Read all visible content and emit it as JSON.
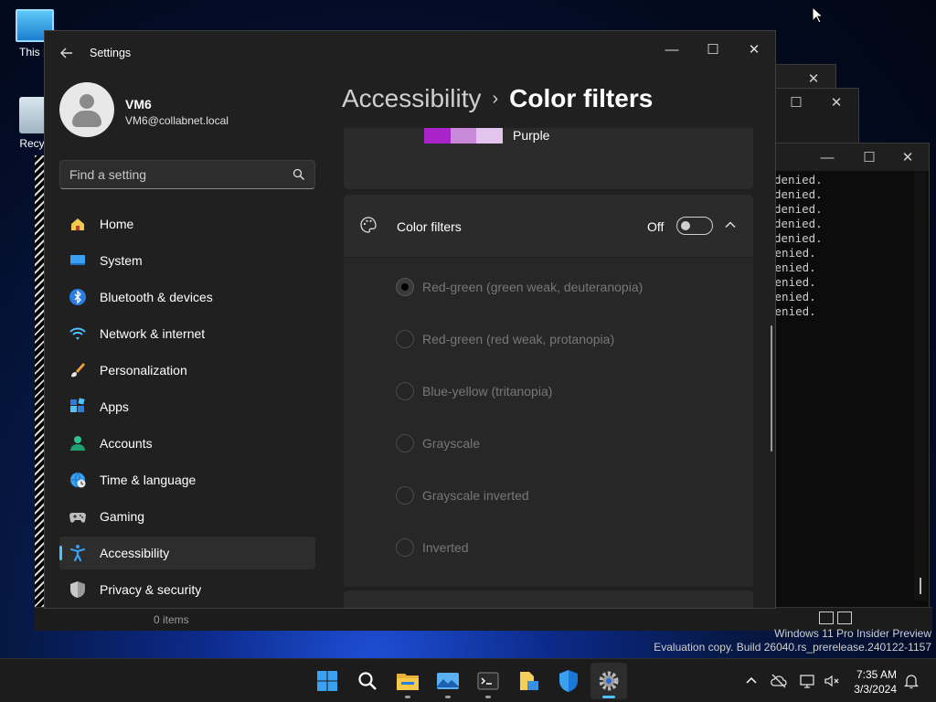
{
  "desktop": {
    "icons": [
      {
        "label": "This PC",
        "visible_label": "This P"
      },
      {
        "label": "Recycle Bin",
        "visible_label": "Recyc"
      }
    ]
  },
  "terminal": {
    "lines": [
      "denied.",
      "denied.",
      "denied.",
      "denied.",
      "denied.",
      "denied.",
      "denied.",
      "denied.",
      "denied.",
      "denied."
    ]
  },
  "explorer": {
    "status": "0 items"
  },
  "watermark": {
    "line1": "Windows 11 Pro Insider Preview",
    "line2": "Evaluation copy. Build 26040.rs_prerelease.240122-1157"
  },
  "settings": {
    "app_title": "Settings",
    "user": {
      "name": "VM6",
      "email": "VM6@collabnet.local"
    },
    "search": {
      "placeholder": "Find a setting"
    },
    "nav": [
      {
        "label": "Home",
        "icon": "home-icon"
      },
      {
        "label": "System",
        "icon": "system-icon"
      },
      {
        "label": "Bluetooth & devices",
        "icon": "bluetooth-icon"
      },
      {
        "label": "Network & internet",
        "icon": "wifi-icon"
      },
      {
        "label": "Personalization",
        "icon": "brush-icon"
      },
      {
        "label": "Apps",
        "icon": "apps-icon"
      },
      {
        "label": "Accounts",
        "icon": "accounts-icon"
      },
      {
        "label": "Time & language",
        "icon": "globe-clock-icon"
      },
      {
        "label": "Gaming",
        "icon": "gamepad-icon"
      },
      {
        "label": "Accessibility",
        "icon": "accessibility-icon",
        "selected": true
      },
      {
        "label": "Privacy & security",
        "icon": "shield-icon"
      }
    ],
    "breadcrumb": {
      "parent": "Accessibility",
      "separator": "›",
      "current": "Color filters"
    },
    "purple_row": {
      "label": "Purple",
      "swatch_colors": [
        "#a824c8",
        "#c88ad8",
        "#e2c4ec"
      ]
    },
    "color_filters": {
      "label": "Color filters",
      "toggle_state": "Off",
      "options": [
        {
          "label": "Red-green (green weak, deuteranopia)",
          "checked": true
        },
        {
          "label": "Red-green (red weak, protanopia)",
          "checked": false
        },
        {
          "label": "Blue-yellow (tritanopia)",
          "checked": false
        },
        {
          "label": "Grayscale",
          "checked": false
        },
        {
          "label": "Grayscale inverted",
          "checked": false
        },
        {
          "label": "Inverted",
          "checked": false
        }
      ]
    }
  },
  "taskbar": {
    "apps": [
      "start-icon",
      "search-icon",
      "file-explorer-icon",
      "photos-icon",
      "terminal-icon",
      "files-icon",
      "security-icon",
      "settings-icon"
    ],
    "active": "settings-icon",
    "clock": {
      "time": "7:35 AM",
      "date": "3/3/2024"
    }
  },
  "colors": {
    "accent": "#4cc2ff",
    "window_bg": "#202020",
    "card_bg": "#2b2b2b"
  }
}
